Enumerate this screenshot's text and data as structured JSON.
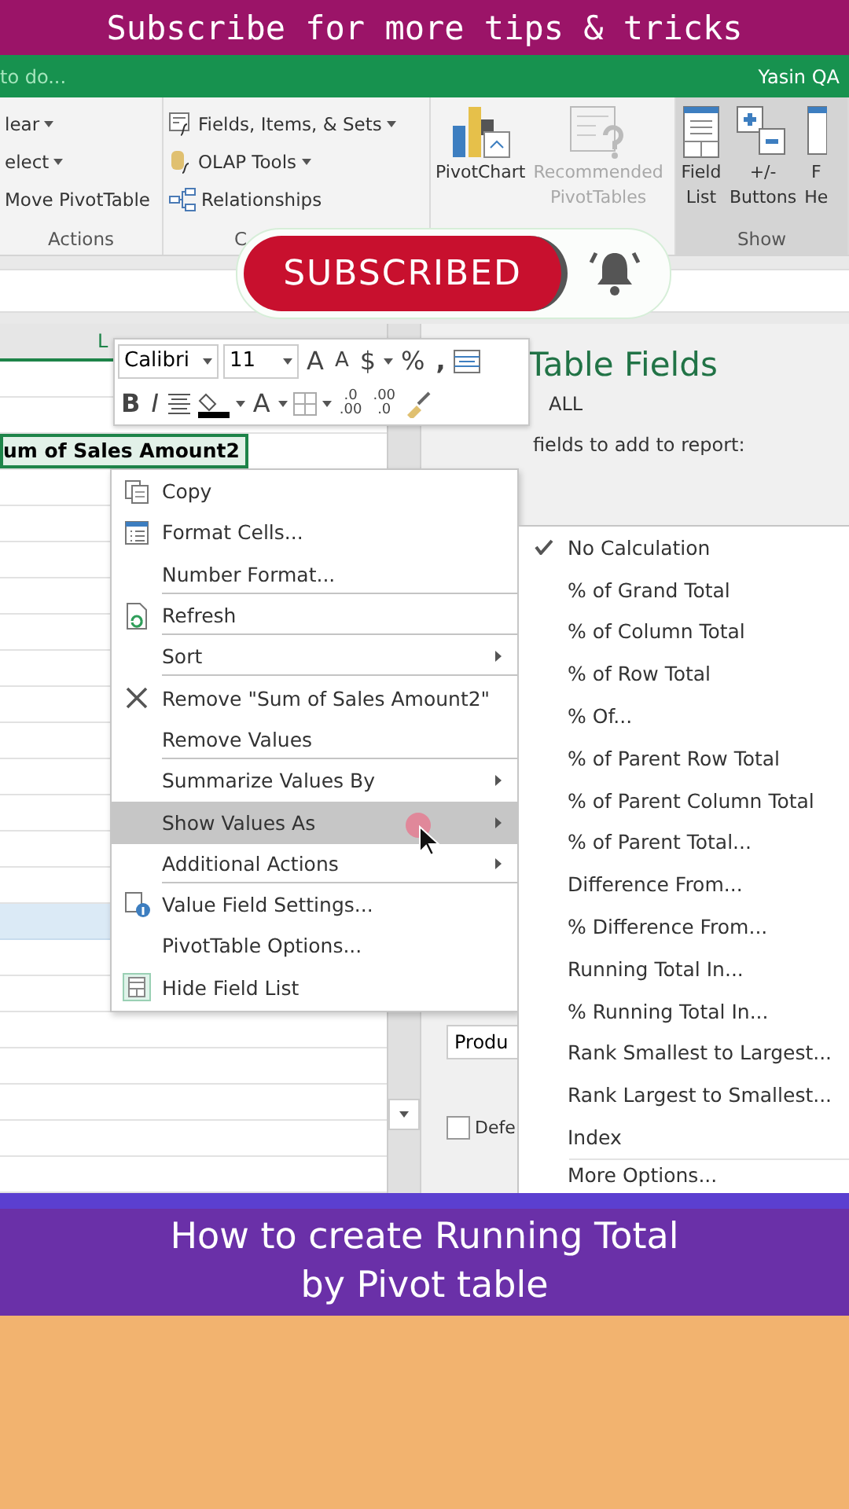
{
  "banner": {
    "text": "Subscribe for more tips & tricks"
  },
  "title_bar": {
    "search_hint": "to do...",
    "user": "Yasin QA"
  },
  "ribbon": {
    "groups": [
      {
        "kind": "list",
        "caption": "Actions",
        "items": [
          {
            "label": "lear",
            "dropdown": true
          },
          {
            "label": "elect",
            "dropdown": true
          },
          {
            "label": "Move PivotTable",
            "dropdown": false
          }
        ]
      },
      {
        "kind": "list",
        "caption": "C",
        "items": [
          {
            "label": "Fields, Items, & Sets",
            "dropdown": true
          },
          {
            "label": "OLAP Tools",
            "dropdown": true
          },
          {
            "label": "Relationships",
            "dropdown": false
          }
        ]
      },
      {
        "kind": "large",
        "items": [
          {
            "lines": [
              "PivotChart"
            ],
            "disabled": false
          },
          {
            "lines": [
              "Recommended",
              "PivotTables"
            ],
            "disabled": true
          }
        ]
      },
      {
        "kind": "large",
        "caption": "Show",
        "highlighted": true,
        "items": [
          {
            "lines": [
              "Field",
              "List"
            ],
            "disabled": false
          },
          {
            "lines": [
              "+/-",
              "Buttons"
            ],
            "disabled": false
          },
          {
            "lines": [
              "F",
              "He"
            ],
            "disabled": false
          }
        ]
      }
    ]
  },
  "subscribe": {
    "label": "SUBSCRIBED"
  },
  "sheet": {
    "column_header": "L",
    "value_header": "um of Sales Amount2"
  },
  "field_panel": {
    "title": "Table Fields",
    "filter": "ALL",
    "hint": "fields to add to report:",
    "area_item": "Produ",
    "defer_label": "Defe",
    "defer_checked": false
  },
  "mini_toolbar": {
    "font": "Calibri",
    "size": "11",
    "grow": "A",
    "shrink": "A",
    "currency": "$",
    "percent": "%",
    "comma": ",",
    "bold": "B",
    "italic": "I",
    "font_color": "A",
    "add_decimal": [
      ".0",
      ".00"
    ],
    "remove_decimal": [
      ".00",
      ".0"
    ]
  },
  "context_menu": [
    {
      "label": "Copy",
      "submenu": false,
      "selected": false,
      "divider_after": false
    },
    {
      "label": "Format Cells...",
      "submenu": false,
      "selected": false,
      "divider_after": false
    },
    {
      "label": "Number Format...",
      "submenu": false,
      "selected": false,
      "divider_after": true
    },
    {
      "label": "Refresh",
      "submenu": false,
      "selected": false,
      "divider_after": true
    },
    {
      "label": "Sort",
      "submenu": true,
      "selected": false,
      "divider_after": true
    },
    {
      "label": "Remove \"Sum of Sales Amount2\"",
      "submenu": false,
      "selected": false,
      "divider_after": false
    },
    {
      "label": "Remove Values",
      "submenu": false,
      "selected": false,
      "divider_after": true
    },
    {
      "label": "Summarize Values By",
      "submenu": true,
      "selected": false,
      "divider_after": false
    },
    {
      "label": "Show Values As",
      "submenu": true,
      "selected": true,
      "divider_after": false
    },
    {
      "label": "Additional Actions",
      "submenu": true,
      "selected": false,
      "divider_after": true
    },
    {
      "label": "Value Field Settings...",
      "submenu": false,
      "selected": false,
      "divider_after": false
    },
    {
      "label": "PivotTable Options...",
      "submenu": false,
      "selected": false,
      "divider_after": false
    },
    {
      "label": "Hide Field List",
      "submenu": false,
      "selected": false,
      "divider_after": false
    }
  ],
  "show_values_menu": [
    {
      "label": "No Calculation",
      "checked": true
    },
    {
      "label": "% of Grand Total",
      "checked": false
    },
    {
      "label": "% of Column Total",
      "checked": false
    },
    {
      "label": "% of Row Total",
      "checked": false
    },
    {
      "label": "% Of...",
      "checked": false
    },
    {
      "label": "% of Parent Row Total",
      "checked": false
    },
    {
      "label": "% of Parent Column Total",
      "checked": false
    },
    {
      "label": "% of Parent Total...",
      "checked": false
    },
    {
      "label": "Difference From...",
      "checked": false
    },
    {
      "label": "% Difference From...",
      "checked": false
    },
    {
      "label": "Running Total In...",
      "checked": false
    },
    {
      "label": "% Running Total In...",
      "checked": false
    },
    {
      "label": "Rank Smallest to Largest...",
      "checked": false
    },
    {
      "label": "Rank Largest to Smallest...",
      "checked": false
    },
    {
      "label": "Index",
      "checked": false
    },
    {
      "label": "More Options...",
      "checked": false
    }
  ],
  "caption": {
    "lines": [
      "How to create Running Total",
      "by Pivot table"
    ]
  }
}
